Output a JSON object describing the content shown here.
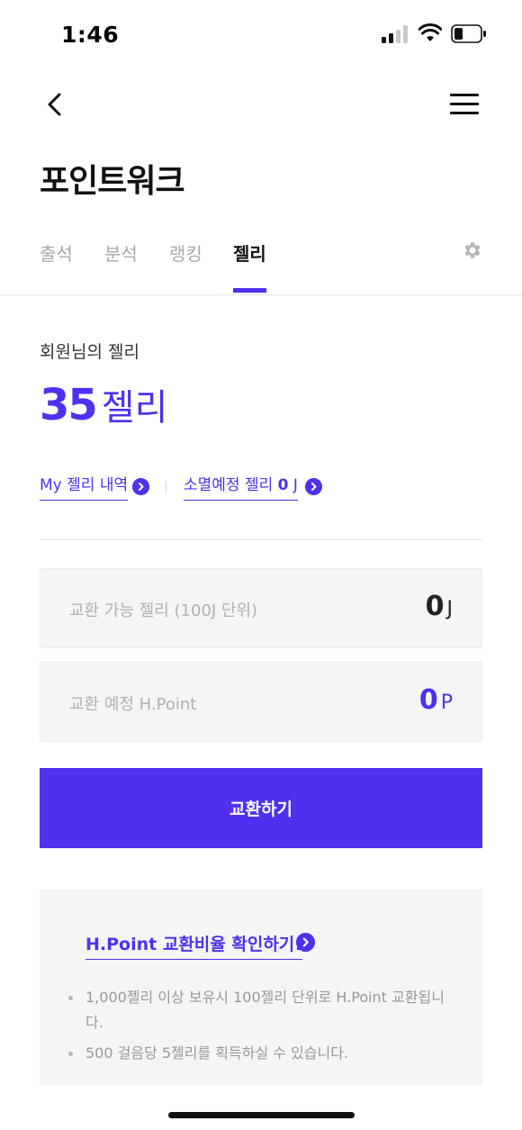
{
  "status_bar": {
    "time": "1:46",
    "icons": [
      "signal-icon",
      "wifi-icon",
      "battery-icon"
    ]
  },
  "nav": {
    "back_icon": "chevron-left-icon",
    "menu_icon": "hamburger-menu-icon"
  },
  "page_title": "포인트워크",
  "tabs": [
    {
      "label": "출석",
      "active": false
    },
    {
      "label": "분석",
      "active": false
    },
    {
      "label": "랭킹",
      "active": false
    },
    {
      "label": "젤리",
      "active": true
    }
  ],
  "settings_icon": "gear-icon",
  "jelly": {
    "label": "회원님의 젤리",
    "amount": "35",
    "unit": "젤리"
  },
  "links": {
    "history": "My 젤리 내역",
    "expiring_label": "소멸예정 젤리",
    "expiring_value": "0",
    "expiring_unit": "J"
  },
  "exchange": {
    "available_label": "교환 가능 젤리 (100J 단위)",
    "available_value": "0",
    "available_unit": "J",
    "expected_label": "교환 예정 H.Point",
    "expected_value": "0",
    "expected_unit": "P",
    "button_label": "교환하기"
  },
  "info": {
    "link": "H.Point 교환비율 확인하기!",
    "items": [
      "1,000젤리 이상 보유시 100젤리 단위로 H.Point 교환됩니다.",
      "500 걸음당 5젤리를 획득하실 수 있습니다."
    ]
  },
  "colors": {
    "accent": "#5030ee",
    "muted_text": "#a8a8a8",
    "field_bg": "#f5f5f5"
  }
}
